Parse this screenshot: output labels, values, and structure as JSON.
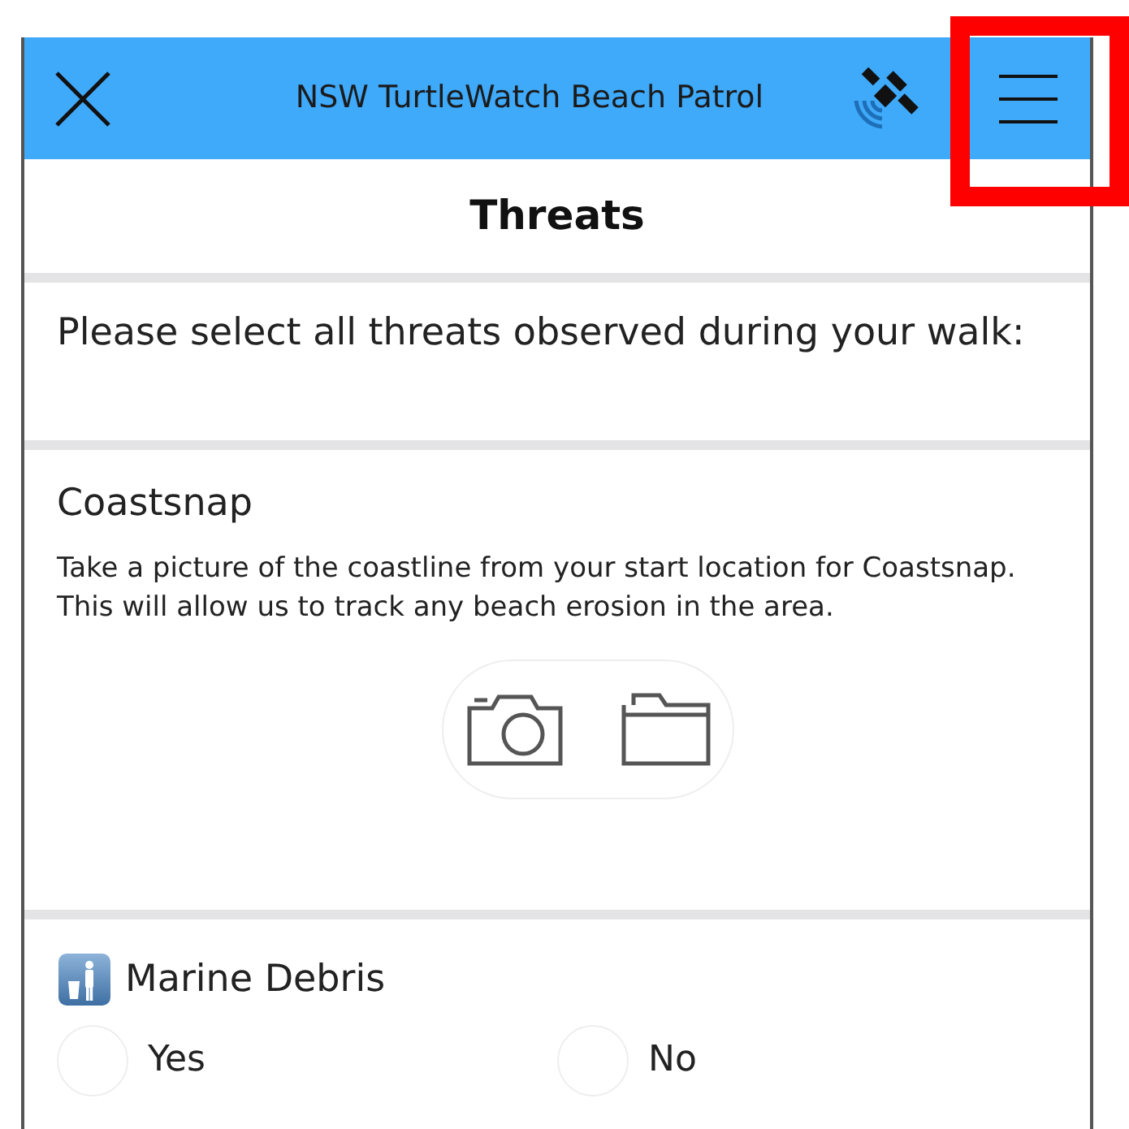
{
  "header": {
    "title": "NSW TurtleWatch Beach Patrol"
  },
  "page": {
    "title": "Threats"
  },
  "prompt": "Please select all threats observed during your walk:",
  "coastsnap": {
    "title": "Coastsnap",
    "description": "Take a picture of the coastline from your start location for Coastsnap. This will allow us to track any beach erosion in the area."
  },
  "question": {
    "title": "Marine Debris",
    "options": [
      {
        "label": "Yes",
        "selected": false
      },
      {
        "label": "No",
        "selected": false
      }
    ]
  }
}
